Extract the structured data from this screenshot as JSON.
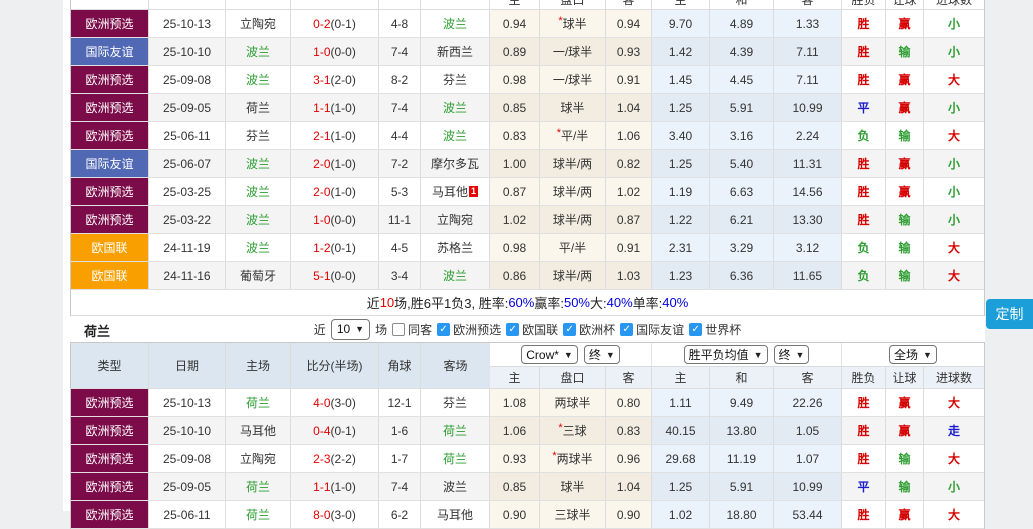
{
  "colors": {
    "badge_maroon": "#7C0C49",
    "badge_blue": "#5168B4",
    "badge_orange": "#F9A000",
    "team_green": "#2E9E32",
    "score_red": "#E60000",
    "win_red": "#D60000",
    "lose_green": "#2E9E32",
    "draw_blue": "#1C1CCE",
    "stat_blue": "#0000E0",
    "customize_bg": "#1C9FD9"
  },
  "customize": {
    "label": "定制"
  },
  "table1": {
    "header_cols": [
      "主",
      "盘口",
      "客",
      "主",
      "和",
      "客",
      "胜负",
      "让球",
      "进球数"
    ],
    "rows": [
      {
        "type": "欧洲预选",
        "tc": "maroon",
        "date": "25-10-13",
        "home": "立陶宛",
        "hg": 0,
        "score": "0-2",
        "half": "(0-1)",
        "corner": "4-8",
        "away": "波兰",
        "ag": 1,
        "ab": "",
        "a1": "0.94",
        "pan": "*球半",
        "a2": "0.94",
        "e1": "9.70",
        "e2": "4.89",
        "e3": "1.33",
        "r": [
          "胜",
          "r"
        ],
        "rq": [
          "赢",
          "r"
        ],
        "jq": [
          "小",
          "g"
        ]
      },
      {
        "type": "国际友谊",
        "tc": "blue",
        "date": "25-10-10",
        "home": "波兰",
        "hg": 1,
        "score": "1-0",
        "half": "(0-0)",
        "corner": "7-4",
        "away": "新西兰",
        "ag": 0,
        "ab": "",
        "a1": "0.89",
        "pan": "一/球半",
        "a2": "0.93",
        "e1": "1.42",
        "e2": "4.39",
        "e3": "7.11",
        "r": [
          "胜",
          "r"
        ],
        "rq": [
          "输",
          "g"
        ],
        "jq": [
          "小",
          "g"
        ]
      },
      {
        "type": "欧洲预选",
        "tc": "maroon",
        "date": "25-09-08",
        "home": "波兰",
        "hg": 1,
        "score": "3-1",
        "half": "(2-0)",
        "corner": "8-2",
        "away": "芬兰",
        "ag": 0,
        "ab": "",
        "a1": "0.98",
        "pan": "一/球半",
        "a2": "0.91",
        "e1": "1.45",
        "e2": "4.45",
        "e3": "7.11",
        "r": [
          "胜",
          "r"
        ],
        "rq": [
          "赢",
          "r"
        ],
        "jq": [
          "大",
          "r"
        ]
      },
      {
        "type": "欧洲预选",
        "tc": "maroon",
        "date": "25-09-05",
        "home": "荷兰",
        "hg": 0,
        "score": "1-1",
        "half": "(1-0)",
        "corner": "7-4",
        "away": "波兰",
        "ag": 1,
        "ab": "",
        "a1": "0.85",
        "pan": "球半",
        "a2": "1.04",
        "e1": "1.25",
        "e2": "5.91",
        "e3": "10.99",
        "r": [
          "平",
          "b"
        ],
        "rq": [
          "赢",
          "r"
        ],
        "jq": [
          "小",
          "g"
        ]
      },
      {
        "type": "欧洲预选",
        "tc": "maroon",
        "date": "25-06-11",
        "home": "芬兰",
        "hg": 0,
        "score": "2-1",
        "half": "(1-0)",
        "corner": "4-4",
        "away": "波兰",
        "ag": 1,
        "ab": "",
        "a1": "0.83",
        "pan": "*平/半",
        "a2": "1.06",
        "e1": "3.40",
        "e2": "3.16",
        "e3": "2.24",
        "r": [
          "负",
          "g"
        ],
        "rq": [
          "输",
          "g"
        ],
        "jq": [
          "大",
          "r"
        ]
      },
      {
        "type": "国际友谊",
        "tc": "blue",
        "date": "25-06-07",
        "home": "波兰",
        "hg": 1,
        "score": "2-0",
        "half": "(1-0)",
        "corner": "7-2",
        "away": "摩尔多瓦",
        "ag": 0,
        "ab": "",
        "a1": "1.00",
        "pan": "球半/两",
        "a2": "0.82",
        "e1": "1.25",
        "e2": "5.40",
        "e3": "11.31",
        "r": [
          "胜",
          "r"
        ],
        "rq": [
          "赢",
          "r"
        ],
        "jq": [
          "小",
          "g"
        ]
      },
      {
        "type": "欧洲预选",
        "tc": "maroon",
        "date": "25-03-25",
        "home": "波兰",
        "hg": 1,
        "score": "2-0",
        "half": "(1-0)",
        "corner": "5-3",
        "away": "马耳他",
        "ag": 0,
        "ab": "1",
        "a1": "0.87",
        "pan": "球半/两",
        "a2": "1.02",
        "e1": "1.19",
        "e2": "6.63",
        "e3": "14.56",
        "r": [
          "胜",
          "r"
        ],
        "rq": [
          "赢",
          "r"
        ],
        "jq": [
          "小",
          "g"
        ]
      },
      {
        "type": "欧洲预选",
        "tc": "maroon",
        "date": "25-03-22",
        "home": "波兰",
        "hg": 1,
        "score": "1-0",
        "half": "(0-0)",
        "corner": "11-1",
        "away": "立陶宛",
        "ag": 0,
        "ab": "",
        "a1": "1.02",
        "pan": "球半/两",
        "a2": "0.87",
        "e1": "1.22",
        "e2": "6.21",
        "e3": "13.30",
        "r": [
          "胜",
          "r"
        ],
        "rq": [
          "输",
          "g"
        ],
        "jq": [
          "小",
          "g"
        ]
      },
      {
        "type": "欧国联",
        "tc": "orange",
        "date": "24-11-19",
        "home": "波兰",
        "hg": 1,
        "score": "1-2",
        "half": "(0-1)",
        "corner": "4-5",
        "away": "苏格兰",
        "ag": 0,
        "ab": "",
        "a1": "0.98",
        "pan": "平/半",
        "a2": "0.91",
        "e1": "2.31",
        "e2": "3.29",
        "e3": "3.12",
        "r": [
          "负",
          "g"
        ],
        "rq": [
          "输",
          "g"
        ],
        "jq": [
          "大",
          "r"
        ]
      },
      {
        "type": "欧国联",
        "tc": "orange",
        "date": "24-11-16",
        "home": "葡萄牙",
        "hg": 0,
        "score": "5-1",
        "half": "(0-0)",
        "corner": "3-4",
        "away": "波兰",
        "ag": 1,
        "ab": "",
        "a1": "0.86",
        "pan": "球半/两",
        "a2": "1.03",
        "e1": "1.23",
        "e2": "6.36",
        "e3": "11.65",
        "r": [
          "负",
          "g"
        ],
        "rq": [
          "输",
          "g"
        ],
        "jq": [
          "大",
          "r"
        ]
      }
    ],
    "summary": [
      [
        "近",
        "k"
      ],
      [
        "10",
        "r"
      ],
      [
        "场,胜6平1负3, 胜率:",
        "k"
      ],
      [
        "60%",
        "b"
      ],
      [
        " 赢率:",
        "k"
      ],
      [
        "50%",
        "b"
      ],
      [
        " 大:",
        "k"
      ],
      [
        "40%",
        "b"
      ],
      [
        " 单率:",
        "k"
      ],
      [
        "40%",
        "b"
      ]
    ]
  },
  "section2": {
    "team": "荷兰",
    "filter": {
      "near": "近",
      "count": "10",
      "games": "场",
      "options": [
        {
          "label": "同客",
          "checked": false
        },
        {
          "label": "欧洲预选",
          "checked": true
        },
        {
          "label": "欧国联",
          "checked": true
        },
        {
          "label": "欧洲杯",
          "checked": true
        },
        {
          "label": "国际友谊",
          "checked": true
        },
        {
          "label": "世界杯",
          "checked": true
        }
      ]
    }
  },
  "table2": {
    "selects": {
      "bookmaker": "Crow*",
      "bk_period": "终",
      "avg": "胜平负均值",
      "avg_period": "终",
      "scope": "全场"
    },
    "header_left": [
      "类型",
      "日期",
      "主场",
      "比分(半场)",
      "角球",
      "客场"
    ],
    "header_cols": [
      "主",
      "盘口",
      "客",
      "主",
      "和",
      "客",
      "胜负",
      "让球",
      "进球数"
    ],
    "rows": [
      {
        "type": "欧洲预选",
        "tc": "maroon",
        "date": "25-10-13",
        "home": "荷兰",
        "hg": 1,
        "score": "4-0",
        "half": "(3-0)",
        "corner": "12-1",
        "away": "芬兰",
        "ag": 0,
        "ab": "",
        "a1": "1.08",
        "pan": "两球半",
        "a2": "0.80",
        "e1": "1.11",
        "e2": "9.49",
        "e3": "22.26",
        "r": [
          "胜",
          "r"
        ],
        "rq": [
          "赢",
          "r"
        ],
        "jq": [
          "大",
          "r"
        ]
      },
      {
        "type": "欧洲预选",
        "tc": "maroon",
        "date": "25-10-10",
        "home": "马耳他",
        "hg": 0,
        "score": "0-4",
        "half": "(0-1)",
        "corner": "1-6",
        "away": "荷兰",
        "ag": 1,
        "ab": "",
        "a1": "1.06",
        "pan": "*三球",
        "a2": "0.83",
        "e1": "40.15",
        "e2": "13.80",
        "e3": "1.05",
        "r": [
          "胜",
          "r"
        ],
        "rq": [
          "赢",
          "r"
        ],
        "jq": [
          "走",
          "b"
        ]
      },
      {
        "type": "欧洲预选",
        "tc": "maroon",
        "date": "25-09-08",
        "home": "立陶宛",
        "hg": 0,
        "score": "2-3",
        "half": "(2-2)",
        "corner": "1-7",
        "away": "荷兰",
        "ag": 1,
        "ab": "",
        "a1": "0.93",
        "pan": "*两球半",
        "a2": "0.96",
        "e1": "29.68",
        "e2": "11.19",
        "e3": "1.07",
        "r": [
          "胜",
          "r"
        ],
        "rq": [
          "输",
          "g"
        ],
        "jq": [
          "大",
          "r"
        ]
      },
      {
        "type": "欧洲预选",
        "tc": "maroon",
        "date": "25-09-05",
        "home": "荷兰",
        "hg": 1,
        "score": "1-1",
        "half": "(1-0)",
        "corner": "7-4",
        "away": "波兰",
        "ag": 0,
        "ab": "",
        "a1": "0.85",
        "pan": "球半",
        "a2": "1.04",
        "e1": "1.25",
        "e2": "5.91",
        "e3": "10.99",
        "r": [
          "平",
          "b"
        ],
        "rq": [
          "输",
          "g"
        ],
        "jq": [
          "小",
          "g"
        ]
      },
      {
        "type": "欧洲预选",
        "tc": "maroon",
        "date": "25-06-11",
        "home": "荷兰",
        "hg": 1,
        "score": "8-0",
        "half": "(3-0)",
        "corner": "6-2",
        "away": "马耳他",
        "ag": 0,
        "ab": "",
        "a1": "0.90",
        "pan": "三球半",
        "a2": "0.90",
        "e1": "1.02",
        "e2": "18.80",
        "e3": "53.44",
        "r": [
          "胜",
          "r"
        ],
        "rq": [
          "赢",
          "r"
        ],
        "jq": [
          "大",
          "r"
        ]
      }
    ]
  }
}
